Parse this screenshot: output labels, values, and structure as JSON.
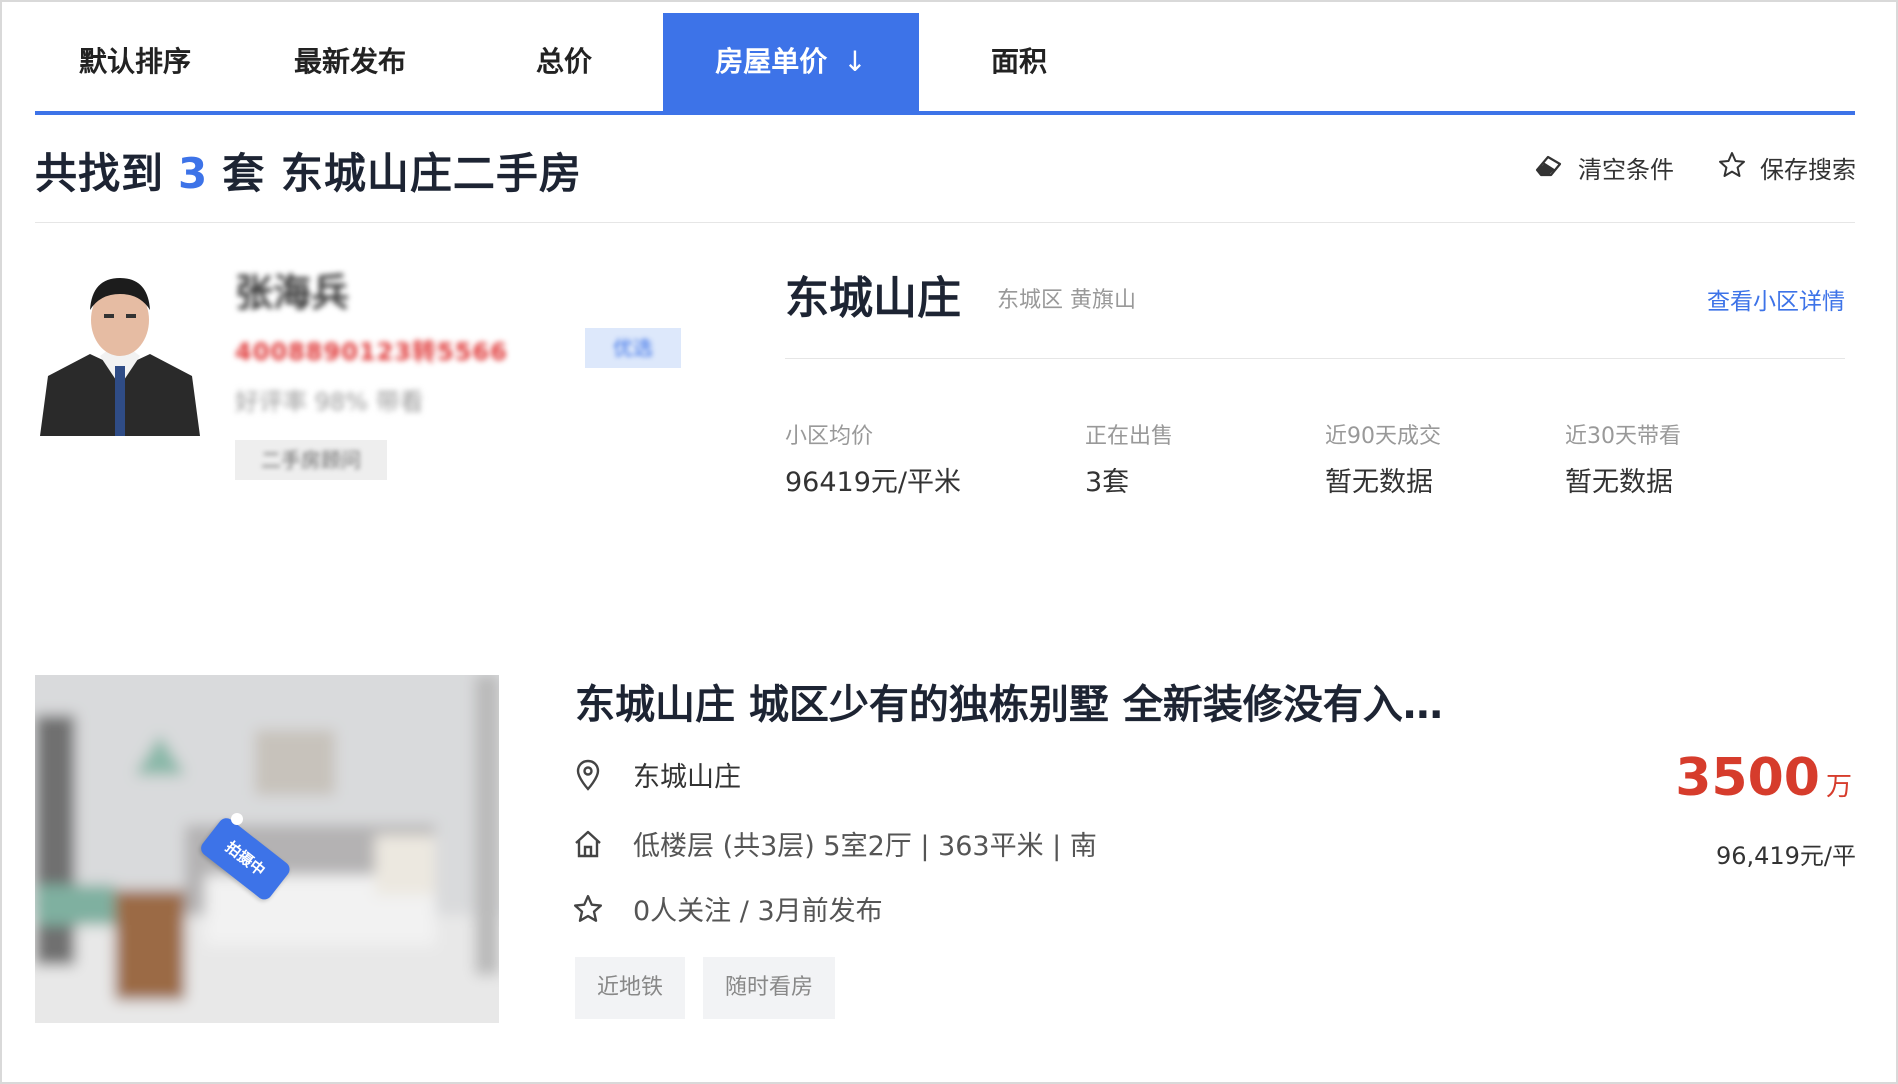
{
  "tabs": [
    {
      "label": "默认排序",
      "active": false
    },
    {
      "label": "最新发布",
      "active": false
    },
    {
      "label": "总价",
      "active": false
    },
    {
      "label": "房屋单价",
      "active": true,
      "arrow": "↓"
    },
    {
      "label": "面积",
      "active": false
    }
  ],
  "header": {
    "prefix": "共找到",
    "count": "3",
    "suffix": "套 东城山庄二手房",
    "clear_label": "清空条件",
    "save_label": "保存搜索"
  },
  "agent": {
    "name": "张海兵",
    "phone": "4008890123转5566",
    "tag": "优选",
    "subtitle": "好评率 98% 带看",
    "badge": "二手房顾问"
  },
  "community": {
    "name": "东城山庄",
    "location": "东城区  黄旗山",
    "link": "查看小区详情",
    "stats": [
      {
        "label": "小区均价",
        "value": "96419元/平米"
      },
      {
        "label": "正在出售",
        "value": "3套"
      },
      {
        "label": "近90天成交",
        "value": "暂无数据"
      },
      {
        "label": "近30天带看",
        "value": "暂无数据"
      }
    ]
  },
  "listing": {
    "title": "东城山庄 城区少有的独栋别墅 全新装修没有入…",
    "community": "东城山庄",
    "details": "低楼层 (共3层) 5室2厅 | 363平米 | 南",
    "follow": "0人关注 / 3月前发布",
    "price": "3500",
    "price_unit": "万",
    "unit_price": "96,419元/平",
    "photo_badge": "拍摄中",
    "tags": [
      "近地铁",
      "随时看房"
    ]
  },
  "colors": {
    "accent": "#3d73e8",
    "price": "#d63c2c"
  }
}
